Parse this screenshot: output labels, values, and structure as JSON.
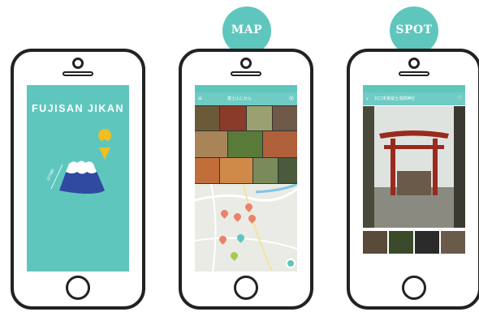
{
  "badges": {
    "map": "MAP",
    "spot": "SPOT"
  },
  "screen1": {
    "title": "FUJISAN JIKAN",
    "altitude_label": "3776M"
  },
  "screen2": {
    "app_bar_title": "富士山じかん"
  },
  "screen3": {
    "app_bar_title": "北口本宮冨士浅間神社"
  },
  "colors": {
    "accent": "#5fc6bd",
    "mountain": "#2f4aa0",
    "pin": "#f0c020",
    "map_pin": "#e8836a"
  }
}
